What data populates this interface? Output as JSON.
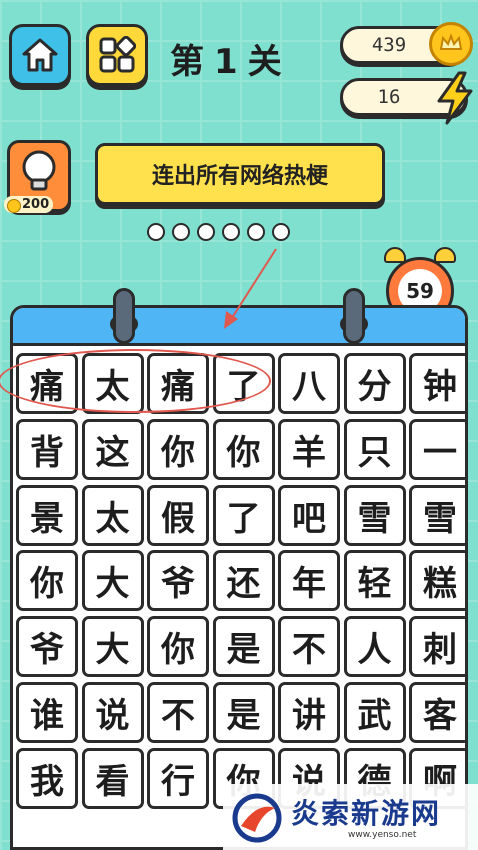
{
  "header": {
    "level_prefix": "第",
    "level_number": "1",
    "level_suffix": "关",
    "coins": "439",
    "energy": "16"
  },
  "hint": {
    "cost": "200"
  },
  "task": {
    "instruction": "连出所有网络热梗"
  },
  "progress_dots": 6,
  "timer": {
    "seconds": "59"
  },
  "grid": {
    "rows": [
      [
        "痛",
        "太",
        "痛",
        "了",
        "八",
        "分",
        "钟"
      ],
      [
        "背",
        "这",
        "你",
        "你",
        "羊",
        "只",
        "一"
      ],
      [
        "景",
        "太",
        "假",
        "了",
        "吧",
        "雪",
        "雪"
      ],
      [
        "你",
        "大",
        "爷",
        "还",
        "年",
        "轻",
        "糕"
      ],
      [
        "爷",
        "大",
        "你",
        "是",
        "不",
        "人",
        "刺"
      ],
      [
        "谁",
        "说",
        "不",
        "是",
        "讲",
        "武",
        "客"
      ],
      [
        "我",
        "看",
        "行",
        "你",
        "说",
        "德",
        "啊"
      ]
    ],
    "highlighted_row": 0,
    "highlighted_cells": 4
  },
  "watermark": {
    "name": "炎索新游网",
    "url": "www.yenso.net"
  },
  "colors": {
    "accent_red": "#e0584e",
    "board_header": "#4fb5f4"
  }
}
